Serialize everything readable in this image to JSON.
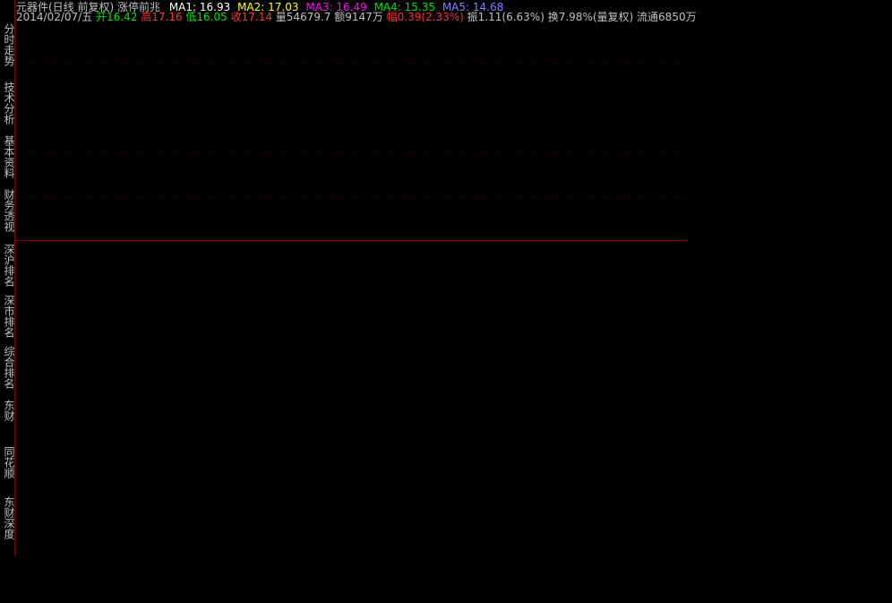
{
  "sidebar": {
    "tabs": [
      "分时走势",
      "技术分析",
      "基本资料",
      "财务透视",
      "深沪排名",
      "深市排名",
      "综合排名",
      "东财",
      "同花顺",
      "东财深度"
    ]
  },
  "header": {
    "title_line": "元器件(日线 前复权) 涨停前兆",
    "ma1": "MA1: 16.93",
    "ma2": "MA2: 17.03",
    "ma3": "MA3: 16.49",
    "ma4": "MA4: 15.35",
    "ma5": "MA5: 14.68",
    "date": "2014/02/07/五",
    "open": "开16.42",
    "high": "高17.16",
    "low": "低16.05",
    "close": "收17.14",
    "vol": "量54679.7",
    "amount": "额9147万",
    "pct": "幅0.39(2.33%)",
    "amp": "振1.11(6.63%)",
    "turnover": "换7.98%(量复权)",
    "float": "流通6850万"
  }
}
